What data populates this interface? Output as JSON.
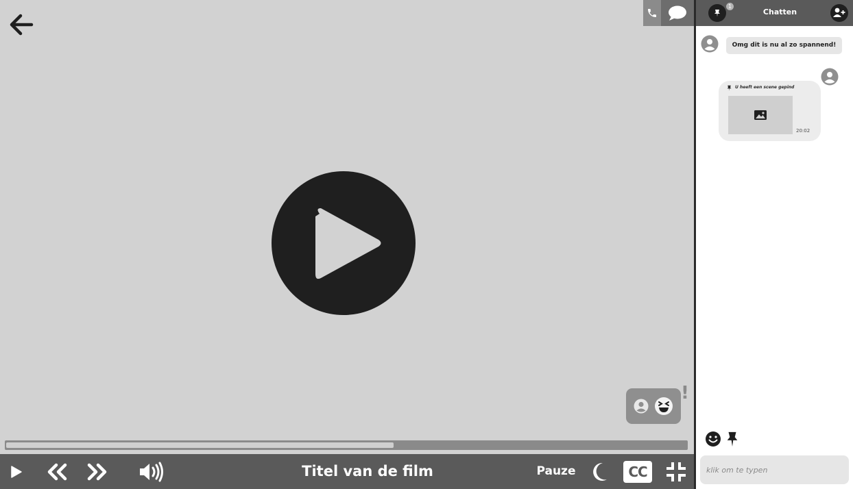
{
  "player": {
    "title": "Titel van de film",
    "pause_label": "Pauze",
    "cc_label": "CC",
    "progress": 0.57,
    "reaction_alert": "!"
  },
  "chat": {
    "title": "Chatten",
    "pinned_count": "1",
    "messages": [
      {
        "text": "Omg dit is nu al zo spannend!"
      }
    ],
    "pinned_scene": {
      "caption": "U heeft een scene gepind",
      "time": "20:02"
    },
    "input_placeholder": "klik om te typen"
  },
  "colors": {
    "control_bar": "#5a5a5a",
    "video_bg": "#d2d2d2",
    "icon_dark": "#1f1f1f"
  }
}
